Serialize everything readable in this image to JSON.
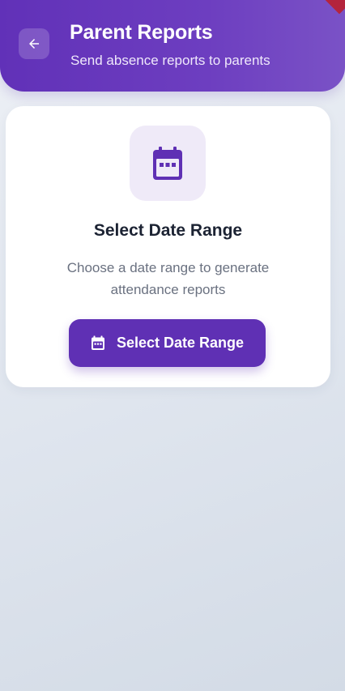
{
  "header": {
    "title": "Parent Reports",
    "subtitle": "Send absence reports to parents",
    "back_icon": "arrow-left-icon"
  },
  "card": {
    "icon": "calendar-icon",
    "title": "Select Date Range",
    "description": "Choose a date range to generate attendance reports",
    "button_label": "Select Date Range",
    "button_icon": "calendar-icon"
  },
  "colors": {
    "primary": "#5f30b4",
    "header_gradient_start": "#6131b8",
    "header_gradient_end": "#7a52c6",
    "icon_tile_bg": "#efeaf8",
    "title_text": "#1c2333",
    "description_text": "#6a7180",
    "ribbon_accent": "#b4243d"
  }
}
